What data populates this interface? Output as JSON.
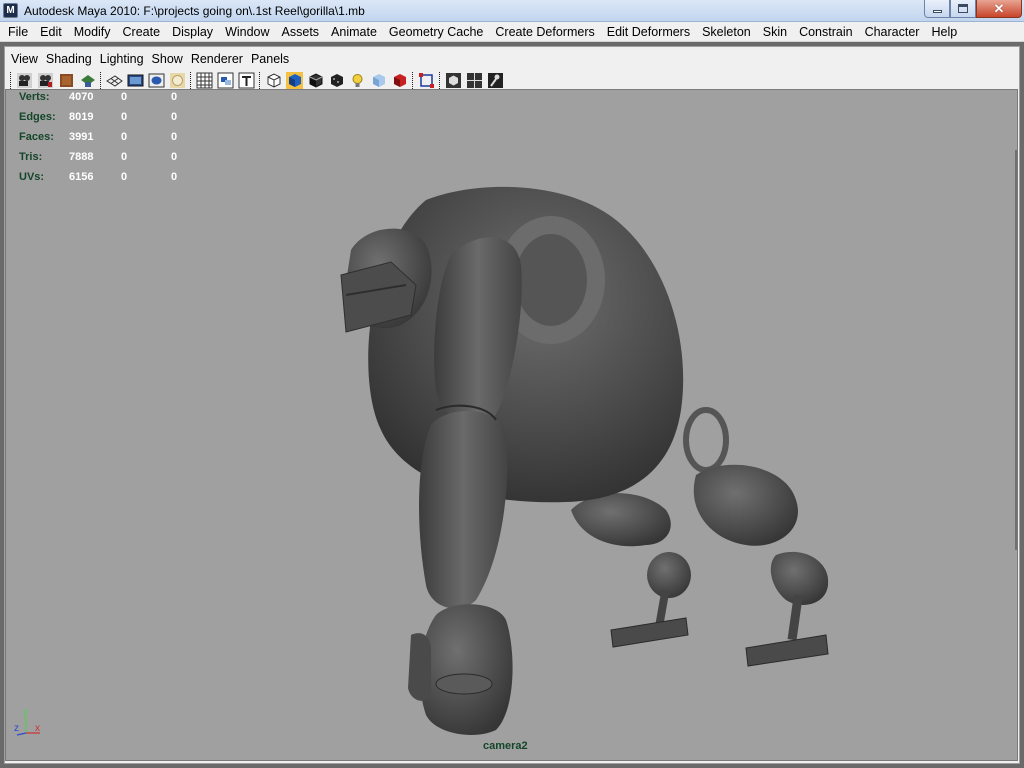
{
  "window": {
    "app_icon": "M",
    "title": "Autodesk Maya 2010: F:\\projects going on\\.1st Reel\\gorilla\\1.mb",
    "close_glyph": "✕"
  },
  "main_menu": [
    "File",
    "Edit",
    "Modify",
    "Create",
    "Display",
    "Window",
    "Assets",
    "Animate",
    "Geometry Cache",
    "Create Deformers",
    "Edit Deformers",
    "Skeleton",
    "Skin",
    "Constrain",
    "Character",
    "Help"
  ],
  "panel_menu": [
    "View",
    "Shading",
    "Lighting",
    "Show",
    "Renderer",
    "Panels"
  ],
  "panel_toolbar_icons": [
    "camera-select-icon",
    "camera-attributes-icon",
    "bookmark-icon",
    "image-plane-icon",
    "grid-icon",
    "film-gate-icon",
    "resolution-gate-icon",
    "gate-mask-icon",
    "field-chart-icon",
    "safe-action-icon",
    "safe-title-icon",
    "wireframe-icon",
    "smooth-shade-icon",
    "wireframe-on-shaded-icon",
    "textured-icon",
    "use-all-lights-icon",
    "shadows-icon",
    "xray-icon",
    "isolate-select-icon",
    "single-view-icon",
    "four-view-icon",
    "script-editor-icon"
  ],
  "hud": {
    "rows": [
      {
        "label": "Verts:",
        "v1": "4070",
        "v2": "0",
        "v3": "0"
      },
      {
        "label": "Edges:",
        "v1": "8019",
        "v2": "0",
        "v3": "0"
      },
      {
        "label": "Faces:",
        "v1": "3991",
        "v2": "0",
        "v3": "0"
      },
      {
        "label": "Tris:",
        "v1": "7888",
        "v2": "0",
        "v3": "0"
      },
      {
        "label": "UVs:",
        "v1": "6156",
        "v2": "0",
        "v3": "0"
      }
    ]
  },
  "camera_label": "camera2",
  "axis": {
    "y": "y",
    "z": "z",
    "x": "x"
  },
  "colors": {
    "viewport_bg": "#a0a0a0",
    "hud_label": "#14462a",
    "model_gray": "#555555"
  }
}
